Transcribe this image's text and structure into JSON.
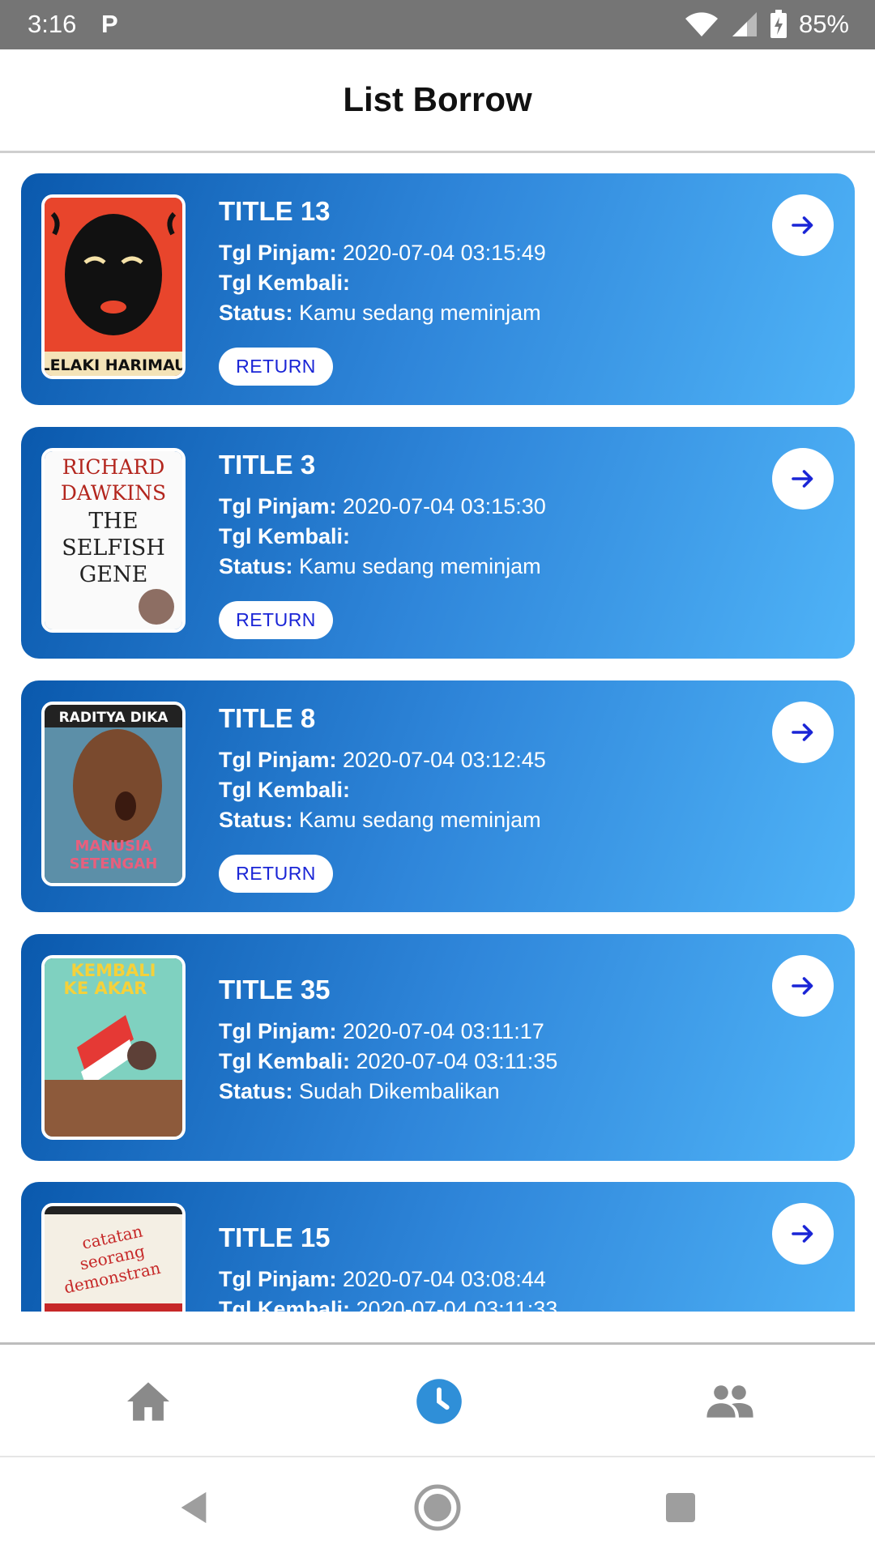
{
  "status_bar": {
    "time": "3:16",
    "app_icon": "P",
    "battery": "85%"
  },
  "header": {
    "title": "List Borrow"
  },
  "labels": {
    "borrow_date": "Tgl Pinjam:",
    "return_date": "Tgl Kembali:",
    "status": "Status:",
    "return_button": "RETURN"
  },
  "cards": [
    {
      "title": "TITLE 13",
      "borrow_date": "2020-07-04 03:15:49",
      "return_date": "",
      "status": "Kamu sedang meminjam",
      "has_return_button": true,
      "cover_text": "LELAKI HARIMAU"
    },
    {
      "title": "TITLE 3",
      "borrow_date": "2020-07-04 03:15:30",
      "return_date": "",
      "status": "Kamu sedang meminjam",
      "has_return_button": true,
      "cover_text": "RICHARD DAWKINS THE SELFISH GENE"
    },
    {
      "title": "TITLE 8",
      "borrow_date": "2020-07-04 03:12:45",
      "return_date": "",
      "status": "Kamu sedang meminjam",
      "has_return_button": true,
      "cover_text": "RADITYA DIKA MANUSIA SETENGAH SALMON"
    },
    {
      "title": "TITLE 35",
      "borrow_date": "2020-07-04 03:11:17",
      "return_date": "2020-07-04 03:11:35",
      "status": "Sudah Dikembalikan",
      "has_return_button": false,
      "cover_text": "KEMBALI KE AKAR"
    },
    {
      "title": "TITLE 15",
      "borrow_date": "2020-07-04 03:08:44",
      "return_date": "2020-07-04 03:11:33",
      "status": "",
      "has_return_button": false,
      "cover_text": "catatan seorang demonstran"
    }
  ],
  "bottom_nav": {
    "items": [
      {
        "icon": "home-icon",
        "active": false
      },
      {
        "icon": "clock-icon",
        "active": true
      },
      {
        "icon": "people-icon",
        "active": false
      }
    ]
  },
  "colors": {
    "accent": "#2f8fd8",
    "card_start": "#0a59ad",
    "card_end": "#4fb3f7",
    "return_text": "#1a25d6",
    "inactive_icon": "#8a8a8a"
  }
}
